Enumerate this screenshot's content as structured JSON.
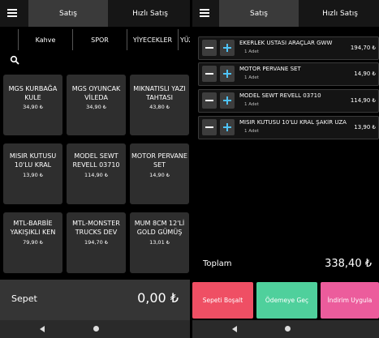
{
  "left": {
    "tabs": [
      "Satış",
      "Hızlı Satış"
    ],
    "categories": [
      "Kahve",
      "SPOR",
      "YİYECEKLER",
      "YÜZ"
    ],
    "products": [
      {
        "name": "MGS KURBAĞA KULE",
        "price": "34,90 ₺"
      },
      {
        "name": "MGS OYUNCAK VİLEDA",
        "price": "34,90 ₺"
      },
      {
        "name": "MIKNATISLI YAZI TAHTASI",
        "price": "43,80 ₺"
      },
      {
        "name": "MISIR KUTUSU 10'LU KRAL",
        "price": "13,90 ₺"
      },
      {
        "name": "MODEL SEWT REVELL 03710",
        "price": "114,90 ₺"
      },
      {
        "name": "MOTOR PERVANE SET",
        "price": "14,90 ₺"
      },
      {
        "name": "MTL-BARBİE YAKIŞIKLI KEN",
        "price": "79,90 ₺"
      },
      {
        "name": "MTL-MONSTER TRUCKS DEV",
        "price": "194,70 ₺"
      },
      {
        "name": "MUM 8CM 12'Lİ GOLD GÜMÜŞ",
        "price": "13,01 ₺"
      }
    ],
    "basket_label": "Sepet",
    "basket_total": "0,00 ₺"
  },
  "right": {
    "tabs": [
      "Satış",
      "Hızlı Satış"
    ],
    "cart": [
      {
        "name": "EKERLEK USTASI ARAÇLAR GWW",
        "qty": "1 Adet",
        "price": "194,70 ₺"
      },
      {
        "name": "MOTOR PERVANE SET",
        "qty": "1 Adet",
        "price": "14,90 ₺"
      },
      {
        "name": "MODEL SEWT REVELL 03710",
        "qty": "1 Adet",
        "price": "114,90 ₺"
      },
      {
        "name": "MISIR KUTUSU 10'LU KRAL ŞAKİR UZA",
        "qty": "1 Adet",
        "price": "13,90 ₺"
      }
    ],
    "total_label": "Toplam",
    "total_value": "338,40 ₺",
    "actions": [
      "Sepeti Boşalt",
      "Ödemeye Geç",
      "İndirim Uygula"
    ]
  },
  "colors": {
    "clear_button": "#ef4f64",
    "pay_button": "#4fd09c",
    "discount_button": "#ec5c9c",
    "plus_icon": "#4fc3f7",
    "card": "#2e2e2e",
    "basket_bar": "#353535"
  },
  "icons": {
    "menu": "menu-icon",
    "search": "search-icon",
    "minus": "minus-icon",
    "plus": "plus-icon",
    "back": "back-icon",
    "home": "home-icon"
  }
}
